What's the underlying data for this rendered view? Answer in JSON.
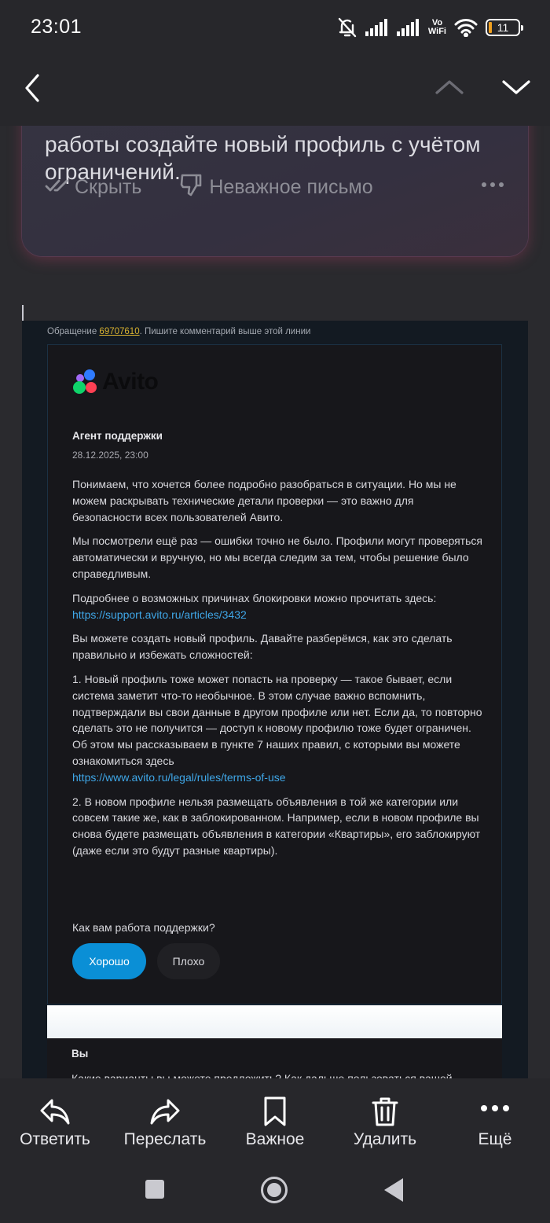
{
  "status_bar": {
    "time": "23:01",
    "vowifi_top": "Vo",
    "vowifi_bottom": "WiFi",
    "battery": "11",
    "battery_level": 0.11,
    "icons": [
      "bell-muted-icon",
      "signal-icon",
      "signal-icon",
      "vowifi-icon",
      "wifi-icon",
      "battery-icon"
    ]
  },
  "top_nav": {
    "icons": [
      "back-arrow-icon",
      "chevron-up-icon",
      "chevron-down-icon"
    ]
  },
  "summary": {
    "text": "работы создайте новый профиль с учётом ограничений.",
    "hide_label": "Скрыть",
    "unimportant_label": "Неважное письмо"
  },
  "email": {
    "ticket_prefix": "Обращение ",
    "ticket_number": "69707610",
    "ticket_suffix": ". Пишите комментарий выше этой линии",
    "logo_text": "Avito",
    "agent_name": "Агент поддержки",
    "date": "28.12.2025, 23:00",
    "p1": "Понимаем, что хочется более подробно разобраться в ситуации. Но мы не можем раскрывать технические детали проверки — это важно для безопасности всех пользователей Авито.",
    "p2": "Мы посмотрели ещё раз — ошибки точно не было. Профили могут проверяться автоматически и вручную, но мы всегда следим за тем, чтобы решение было справедливым.",
    "p3": "Подробнее о возможных причинах блокировки можно прочитать здесь:",
    "p3_link": "https://support.avito.ru/articles/3432",
    "p4": "Вы можете создать новый профиль. Давайте разберёмся, как это сделать правильно и избежать сложностей:",
    "p5": "1. Новый профиль тоже может попасть на проверку — такое бывает, если система заметит что-то необычное. В этом случае важно вспомнить, подтверждали вы свои данные в другом профиле или нет. Если да, то повторно сделать это не получится — доступ к новому профилю тоже будет ограничен. Об этом мы рассказываем в пункте 7 наших правил, с которыми вы можете ознакомиться здесь",
    "p5_link": "https://www.avito.ru/legal/rules/terms-of-use",
    "p6": "2. В новом профиле нельзя размещать объявления в той же категории или совсем такие же, как в заблокированном. Например, если в новом профиле вы снова будете размещать объявления в категории «Квартиры», его заблокируют (даже если это будут разные квартиры).",
    "rating_question": "Как вам работа поддержки?",
    "rating_good": "Хорошо",
    "rating_bad": "Плохо",
    "prev_author": "Вы",
    "prev_text": "Какие варианты вы можете предложить? Как дальше пользоваться вашей"
  },
  "toolbar": {
    "items": [
      {
        "label": "Ответить",
        "icon": "reply-icon"
      },
      {
        "label": "Переслать",
        "icon": "forward-icon"
      },
      {
        "label": "Важное",
        "icon": "bookmark-icon"
      },
      {
        "label": "Удалить",
        "icon": "trash-icon"
      },
      {
        "label": "Ещё",
        "icon": "more-dots-icon"
      }
    ]
  },
  "system_nav": {
    "icons": [
      "recents-square-icon",
      "home-circle-icon",
      "back-triangle-icon"
    ]
  }
}
